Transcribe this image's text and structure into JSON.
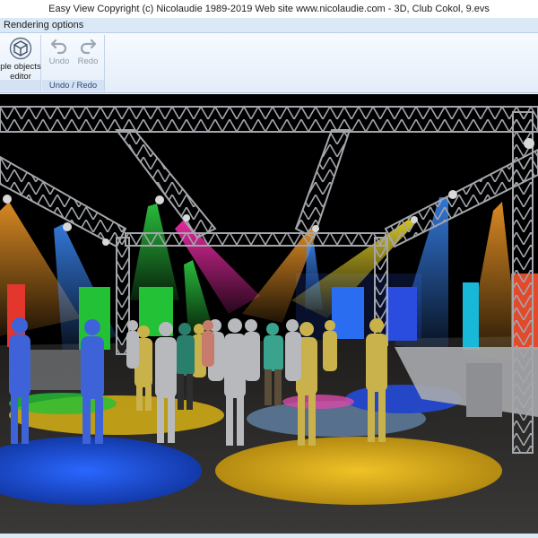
{
  "window": {
    "title": "Easy View   Copyright (c) Nicolaudie 1989-2019   Web site www.nicolaudie.com - 3D, Club Cokol, 9.evs"
  },
  "tabs": {
    "active": "Rendering options"
  },
  "ribbon": {
    "editor_group": {
      "button_line1": "ple objects",
      "button_line2": "editor"
    },
    "undo_group": {
      "label": "Undo / Redo",
      "undo_label": "Undo",
      "redo_label": "Redo"
    }
  },
  "scene": {
    "background": "#000000",
    "truss_color": "#9a9da3",
    "floor_color": "#2e2d2b",
    "accent_colors": {
      "blue": "#1f55d6",
      "yellow": "#d7b015",
      "green": "#23c236",
      "orange": "#e08a1c",
      "magenta": "#d6279a",
      "red": "#e3362c",
      "cyan": "#18b8d9"
    }
  }
}
